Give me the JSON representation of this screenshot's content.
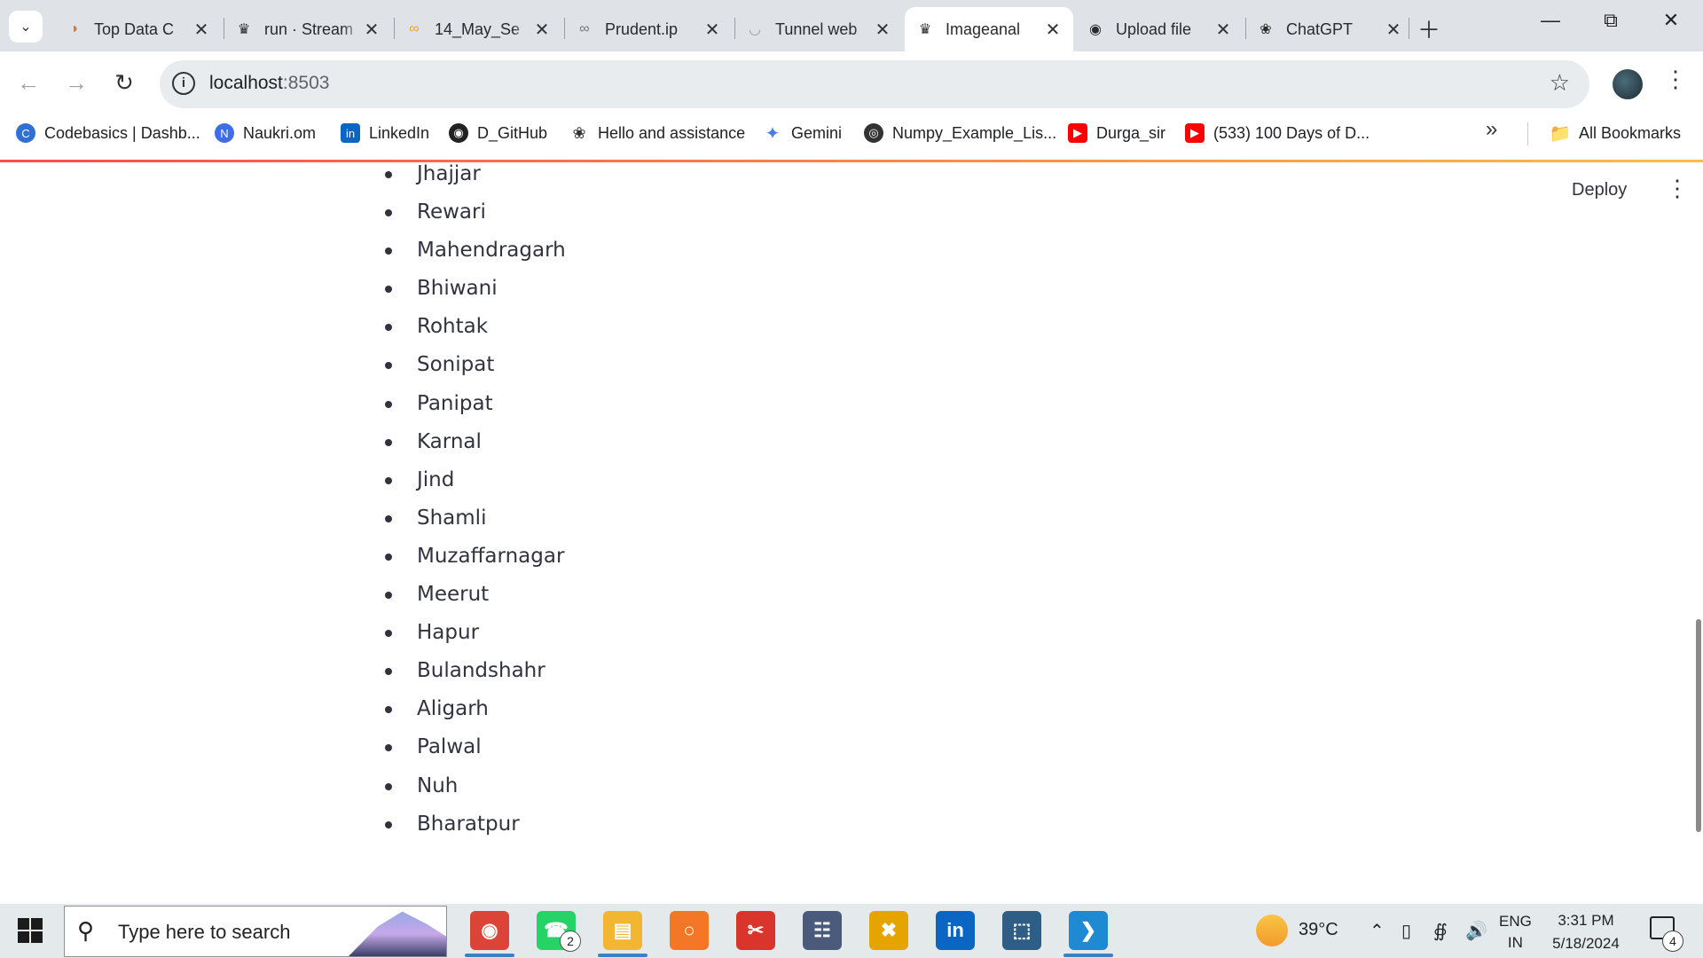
{
  "browser": {
    "tabs": [
      {
        "title": "Top Data C",
        "favicon": "orange-logo-icon",
        "active": false
      },
      {
        "title": "run · Stream",
        "favicon": "streamlit-crown-icon",
        "active": false
      },
      {
        "title": "14_May_Se",
        "favicon": "colab-icon",
        "active": false
      },
      {
        "title": "Prudent.ip",
        "favicon": "colab-gray-icon",
        "active": false
      },
      {
        "title": "Tunnel web",
        "favicon": "loading-spinner-icon",
        "active": false
      },
      {
        "title": "Imageanal",
        "favicon": "streamlit-crown-icon",
        "active": true
      },
      {
        "title": "Upload file",
        "favicon": "github-icon",
        "active": false
      },
      {
        "title": "ChatGPT",
        "favicon": "openai-icon",
        "active": false
      }
    ],
    "address": {
      "host": "localhost",
      "port": ":8503"
    },
    "bookmarks": [
      {
        "label": "Codebasics | Dashb...",
        "icon": "codebasics-icon",
        "color": "#2f6fd6"
      },
      {
        "label": "Naukri.om",
        "icon": "naukri-icon",
        "color": "#3d6ee8"
      },
      {
        "label": "LinkedIn",
        "icon": "linkedin-icon",
        "color": "#0a66c2"
      },
      {
        "label": "D_GitHub",
        "icon": "github-icon",
        "color": "#222222"
      },
      {
        "label": "Hello and assistance",
        "icon": "openai-icon",
        "color": "#444444"
      },
      {
        "label": "Gemini",
        "icon": "gemini-sparkle-icon",
        "color": "#4b7bec"
      },
      {
        "label": "Numpy_Example_Lis...",
        "icon": "globe-icon",
        "color": "#333333"
      },
      {
        "label": "Durga_sir",
        "icon": "youtube-icon",
        "color": "#ff0000"
      },
      {
        "label": "(533) 100 Days of D...",
        "icon": "youtube-icon",
        "color": "#ff0000"
      }
    ],
    "all_bookmarks": "All Bookmarks"
  },
  "app": {
    "deploy_label": "Deploy",
    "cities": [
      "Jhajjar",
      "Rewari",
      "Mahendragarh",
      "Bhiwani",
      "Rohtak",
      "Sonipat",
      "Panipat",
      "Karnal",
      "Jind",
      "Shamli",
      "Muzaffarnagar",
      "Meerut",
      "Hapur",
      "Bulandshahr",
      "Aligarh",
      "Palwal",
      "Nuh",
      "Bharatpur"
    ]
  },
  "taskbar": {
    "search_placeholder": "Type here to search",
    "apps": [
      {
        "name": "chrome",
        "icon": "chrome-icon",
        "color": "#db4437",
        "badge": ""
      },
      {
        "name": "whatsapp",
        "icon": "whatsapp-icon",
        "color": "#25d366",
        "badge": "2"
      },
      {
        "name": "file-explorer",
        "icon": "folder-icon",
        "color": "#f2b632",
        "badge": ""
      },
      {
        "name": "jupyter",
        "icon": "jupyter-icon",
        "color": "#f37726",
        "badge": ""
      },
      {
        "name": "snip",
        "icon": "snipping-tool-icon",
        "color": "#d9352c",
        "badge": ""
      },
      {
        "name": "calculator",
        "icon": "calculator-icon",
        "color": "#4a5a7a",
        "badge": ""
      },
      {
        "name": "excel-like",
        "icon": "spreadsheet-icon",
        "color": "#e5a400",
        "badge": ""
      },
      {
        "name": "linkedin",
        "icon": "linkedin-icon",
        "color": "#0a66c2",
        "badge": ""
      },
      {
        "name": "mysql",
        "icon": "mysql-workbench-icon",
        "color": "#2e5d86",
        "badge": ""
      },
      {
        "name": "vscode",
        "icon": "vscode-icon",
        "color": "#1f8ad2",
        "badge": ""
      }
    ],
    "temperature": "39°C",
    "lang_top": "ENG",
    "lang_bottom": "IN",
    "time": "3:31 PM",
    "date": "5/18/2024",
    "notifications": "4"
  }
}
